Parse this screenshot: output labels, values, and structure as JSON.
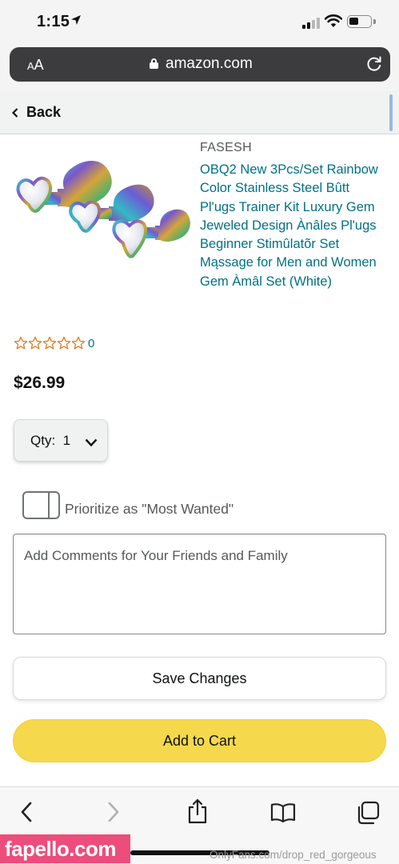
{
  "status_bar": {
    "time": "1:15",
    "location_icon": "location-arrow-icon",
    "signal_bars_active": 2,
    "battery_level": 0.35
  },
  "browser": {
    "text_size_label": "AA",
    "url": "amazon.com"
  },
  "header": {
    "back_label": "Back"
  },
  "product": {
    "brand": "FASESH",
    "title": "OBQ2 New 3Pcs/Set Rainbow Color Stainless Steel Bûtt Pl'ugs Trainer Kit Luxury Gem Jeweled Design Ànâles Pl'ugs Beginner Stimûlatõr Set Mąssage for Men and Women Gem Àmâl Set (White)",
    "rating_stars_filled": 0,
    "rating_count": "0",
    "price": "$26.99",
    "qty_label": "Qty:  1"
  },
  "wishlist": {
    "prioritize_label": "Prioritize as \"Most Wanted\"",
    "prioritize_checked": false,
    "comments_placeholder": "Add Comments for Your Friends and Family",
    "comments_value": ""
  },
  "actions": {
    "save_label": "Save Changes",
    "cart_label": "Add to Cart"
  },
  "overlay": {
    "watermark": "fapello.com",
    "credit": "OnlyFans.com/drop_red_gorgeous"
  },
  "colors": {
    "link": "#007185",
    "cart_button": "#f6d84c",
    "star_outline": "#de7921"
  }
}
